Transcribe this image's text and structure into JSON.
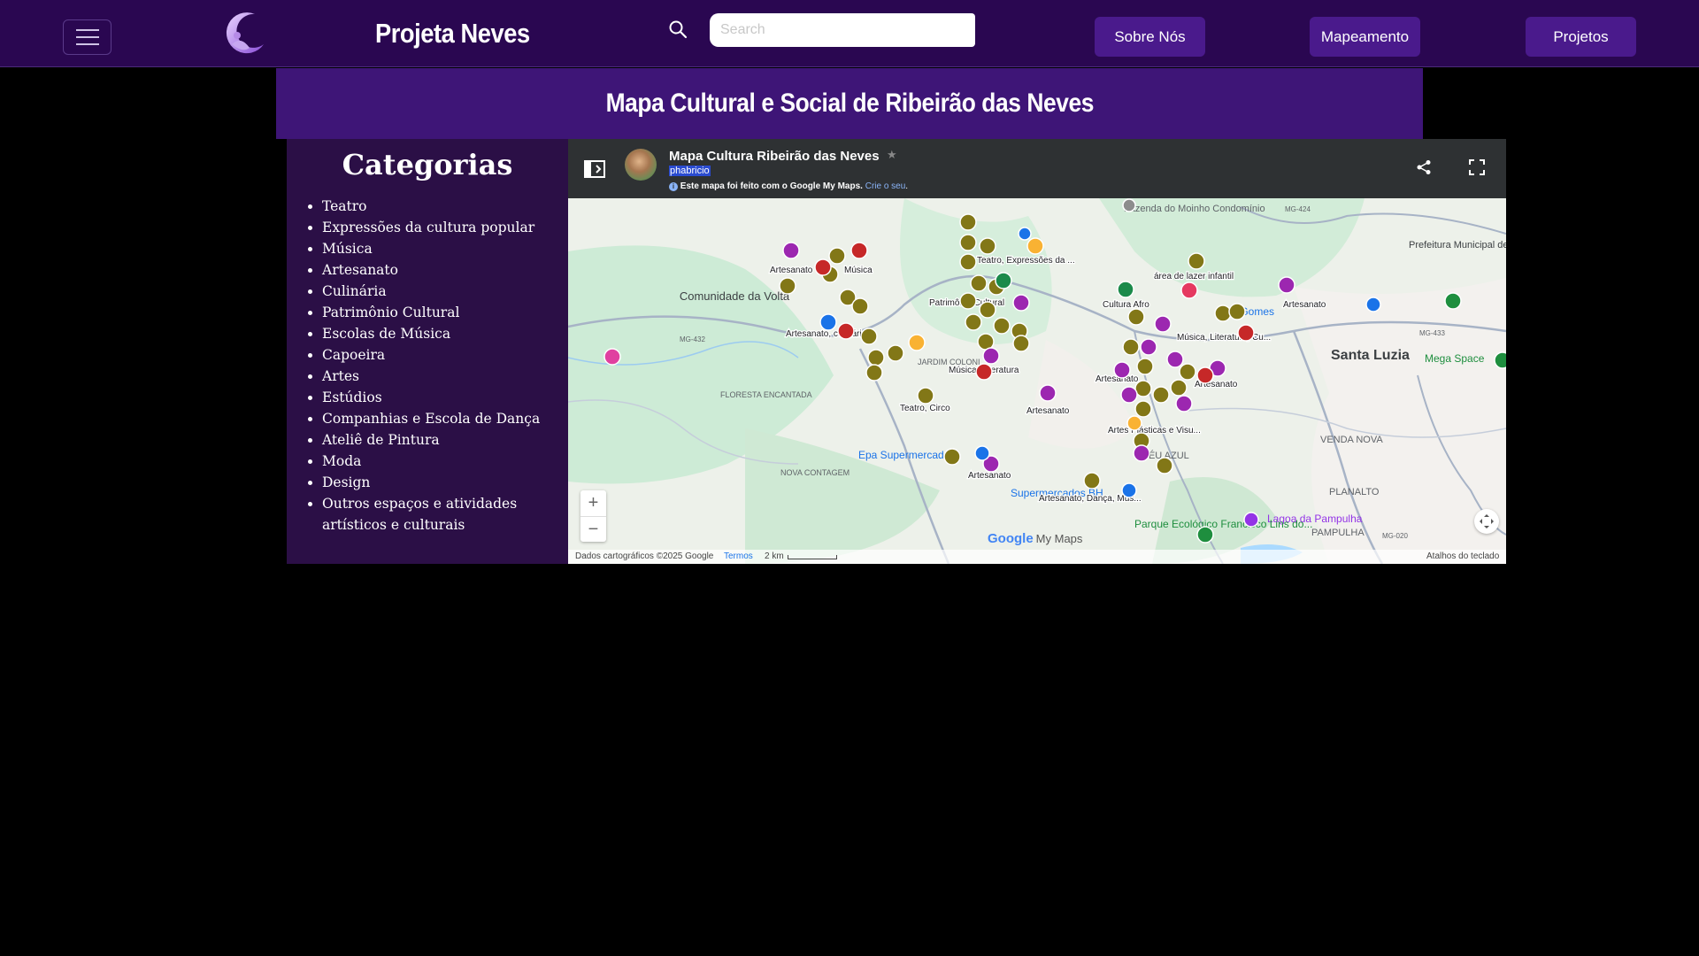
{
  "navbar": {
    "brand": "Projeta Neves",
    "search_placeholder": "Search",
    "buttons": [
      "Sobre Nós",
      "Mapeamento",
      "Projetos"
    ],
    "colors": {
      "bg": "#2a0751",
      "button": "#4a1a8c"
    }
  },
  "page": {
    "title": "Mapa Cultural e Social de Ribeirão das Neves"
  },
  "sidebar": {
    "heading": "Categorias",
    "items": [
      "Teatro",
      "Expressões da cultura popular",
      "Música",
      "Artesanato",
      "Culinária",
      "Patrimônio Cultural",
      "Escolas de Música",
      "Capoeira",
      "Artes",
      "Estúdios",
      "Companhias e Escola de Dança",
      "Ateliê de Pintura",
      "Moda",
      "Design",
      "Outros espaços e atividades artísticos e culturais"
    ]
  },
  "map": {
    "title": "Mapa Cultura Ribeirão das Neves",
    "owner": "phabricio",
    "made_with": "Este mapa foi feito com o Google My Maps.",
    "create_link": "Crie o seu",
    "logo": "Google",
    "logo_suffix": "My Maps",
    "attribution": "Dados cartográficos ©2025 Google",
    "terms": "Termos",
    "scale": "2 km",
    "shortcuts": "Atalhos do teclado",
    "zoom_in": "+",
    "zoom_out": "−",
    "place_labels": {
      "comunidade": "Comunidade da Volta",
      "santa_luzia": "Santa Luzia",
      "mega_space": "Mega Space",
      "prefeitura": "Prefeitura Municipal de Santa Luzia",
      "lagoa": "Lagoa da Pampulha",
      "parque": "Parque Ecológico Francisco Lins do...",
      "epa": "Epa Supermercados",
      "super_bh": "Supermercados BH",
      "gomes": "s Gomes",
      "ceu_azul": "CÉU AZUL",
      "venda_nova": "VENDA NOVA",
      "planalto": "PLANALTO",
      "pampulha": "PAMPULHA",
      "floresta": "FLORESTA ENCANTADA",
      "nova_contagem": "NOVA CONTAGEM",
      "jardim": "JARDIM COLONI...",
      "fazenda": "Fazenda do Moinho Condomínio",
      "mg432": "MG-432",
      "mg424": "MG-424",
      "mg433": "MG-433",
      "mg020": "MG-020"
    },
    "marker_labels": [
      "Artesanato",
      "Música",
      "Teatro, Expressões da ...",
      "área de lazer infantil",
      "Patrimônio Cultural",
      "Cultura Afro",
      "Artesanato",
      "Artesanato, culinária",
      "Música, Literatura, Cu...",
      "Música, Literatura",
      "Artesanato",
      "Artesanato",
      "Teatro, Circo",
      "Artesanato",
      "Artes Plásticas e Visu...",
      "Artesanato",
      "Artesanato, Dança, Mús..."
    ]
  }
}
